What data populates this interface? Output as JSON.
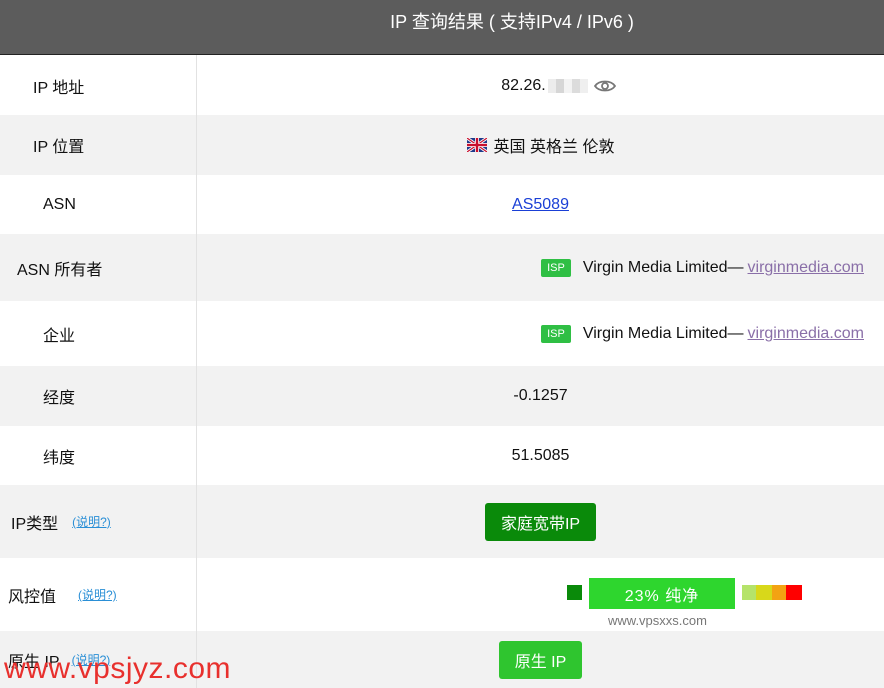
{
  "header": {
    "title": "IP 查询结果 ( 支持IPv4 / IPv6 )"
  },
  "rows": {
    "ip": {
      "label": "IP 地址",
      "value": "82.26."
    },
    "location": {
      "label": "IP 位置",
      "flag": "uk-flag",
      "value": "英国 英格兰 伦敦"
    },
    "asn": {
      "label": "ASN",
      "value": "AS5089"
    },
    "asn_owner": {
      "label": "ASN 所有者",
      "badge": "ISP",
      "name": "Virgin Media Limited—",
      "site": "virginmedia.com"
    },
    "company": {
      "label": "企业",
      "badge": "ISP",
      "name": "Virgin Media Limited—",
      "site": "virginmedia.com"
    },
    "longitude": {
      "label": "经度",
      "value": "-0.1257"
    },
    "latitude": {
      "label": "纬度",
      "value": "51.5085"
    },
    "ip_type": {
      "label": "IP类型",
      "help": "(说明?)",
      "value": "家庭宽带IP"
    },
    "risk": {
      "label": "风控值",
      "help": "(说明?)",
      "value": "23%   纯净",
      "percent": 23,
      "caption": "www.vpsxxs.com"
    },
    "native": {
      "label": "原生 IP",
      "help": "(说明?)",
      "value": "原生 IP"
    }
  },
  "watermark": "www.vpsjyz.com",
  "colors": {
    "header_bg": "#5c5c5c",
    "type_button": "#0a8a0a",
    "risk_bar": "#2ed62e",
    "scale": [
      "#b5e36a",
      "#d8d81a",
      "#f3a312",
      "#ff0000"
    ],
    "watermark": "#e8302d"
  }
}
